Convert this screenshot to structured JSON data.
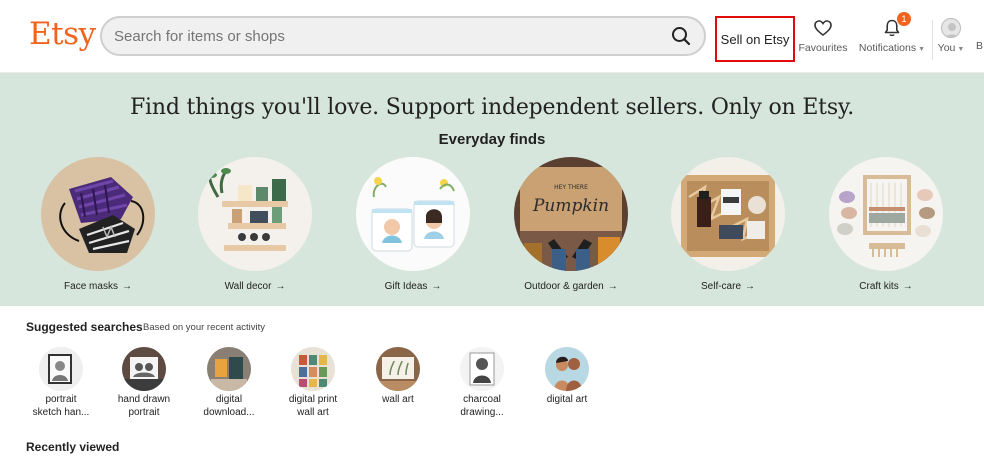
{
  "header": {
    "logo": "Etsy",
    "search_placeholder": "Search for items or shops",
    "sell_label": "Sell on Etsy",
    "favourites_label": "Favourites",
    "notifications_label": "Notifications",
    "notifications_count": "1",
    "you_label": "You",
    "cut_label": "B"
  },
  "hero": {
    "title": "Find things you'll love. Support independent sellers. Only on Etsy.",
    "subtitle": "Everyday finds",
    "categories": [
      {
        "label": "Face masks",
        "icon": "face-masks-photo"
      },
      {
        "label": "Wall decor",
        "icon": "wall-decor-photo"
      },
      {
        "label": "Gift Ideas",
        "icon": "gift-ideas-photo"
      },
      {
        "label": "Outdoor & garden",
        "icon": "doormat-photo",
        "mat_text_top": "HEY THERE",
        "mat_text": "Pumpkin"
      },
      {
        "label": "Self-care",
        "icon": "self-care-box-photo"
      },
      {
        "label": "Craft kits",
        "icon": "craft-kits-photo"
      }
    ]
  },
  "suggested": {
    "heading": "Suggested searches",
    "note": "Based on your recent activity",
    "items": [
      {
        "line1": "portrait",
        "line2": "sketch han..."
      },
      {
        "line1": "hand drawn",
        "line2": "portrait"
      },
      {
        "line1": "digital",
        "line2": "download..."
      },
      {
        "line1": "digital print",
        "line2": "wall art"
      },
      {
        "line1": "wall art",
        "line2": ""
      },
      {
        "line1": "charcoal",
        "line2": "drawing..."
      },
      {
        "line1": "digital art",
        "line2": ""
      }
    ]
  },
  "recently_viewed": "Recently viewed",
  "colors": {
    "brand": "#f1641e",
    "hero_bg": "#d7e6dc",
    "highlight_border": "#e00b0b"
  }
}
